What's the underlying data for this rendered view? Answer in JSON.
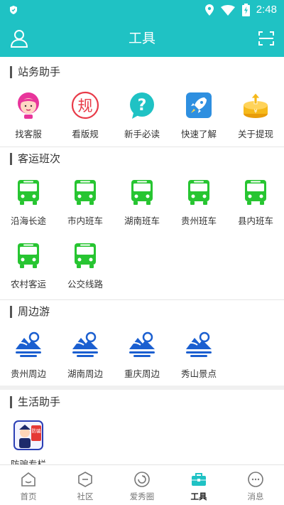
{
  "status_bar": {
    "time": "2:48"
  },
  "header": {
    "title": "工具"
  },
  "sections": [
    {
      "title": "站务助手",
      "items": [
        {
          "label": "找客服",
          "icon": "customer-service-icon"
        },
        {
          "label": "看版规",
          "icon": "rules-icon"
        },
        {
          "label": "新手必读",
          "icon": "help-icon"
        },
        {
          "label": "快速了解",
          "icon": "rocket-icon"
        },
        {
          "label": "关于提现",
          "icon": "withdraw-icon"
        }
      ]
    },
    {
      "title": "客运班次",
      "items": [
        {
          "label": "沿海长途",
          "icon": "bus-icon"
        },
        {
          "label": "市内班车",
          "icon": "bus-icon"
        },
        {
          "label": "湖南班车",
          "icon": "bus-icon"
        },
        {
          "label": "贵州班车",
          "icon": "bus-icon"
        },
        {
          "label": "县内班车",
          "icon": "bus-icon"
        },
        {
          "label": "农村客运",
          "icon": "bus-icon"
        },
        {
          "label": "公交线路",
          "icon": "bus-icon"
        }
      ]
    },
    {
      "title": "周边游",
      "items": [
        {
          "label": "贵州周边",
          "icon": "mountain-icon"
        },
        {
          "label": "湖南周边",
          "icon": "mountain-icon"
        },
        {
          "label": "重庆周边",
          "icon": "mountain-icon"
        },
        {
          "label": "秀山景点",
          "icon": "mountain-icon"
        }
      ]
    },
    {
      "title": "生活助手",
      "items": [
        {
          "label": "防骗专栏",
          "icon": "anti-fraud-icon",
          "badge": "防骗"
        }
      ]
    }
  ],
  "tabs": [
    {
      "label": "首页",
      "icon": "home-icon",
      "active": false
    },
    {
      "label": "社区",
      "icon": "community-icon",
      "active": false
    },
    {
      "label": "爱秀圈",
      "icon": "circle-icon",
      "active": false
    },
    {
      "label": "工具",
      "icon": "toolbox-icon",
      "active": true
    },
    {
      "label": "消息",
      "icon": "message-icon",
      "active": false
    }
  ],
  "colors": {
    "primary": "#1fc2c4",
    "bus_green": "#27c531",
    "mountain_blue": "#1b5fd0",
    "rules_red": "#e83a48",
    "withdraw_yellow": "#f6b91a"
  }
}
